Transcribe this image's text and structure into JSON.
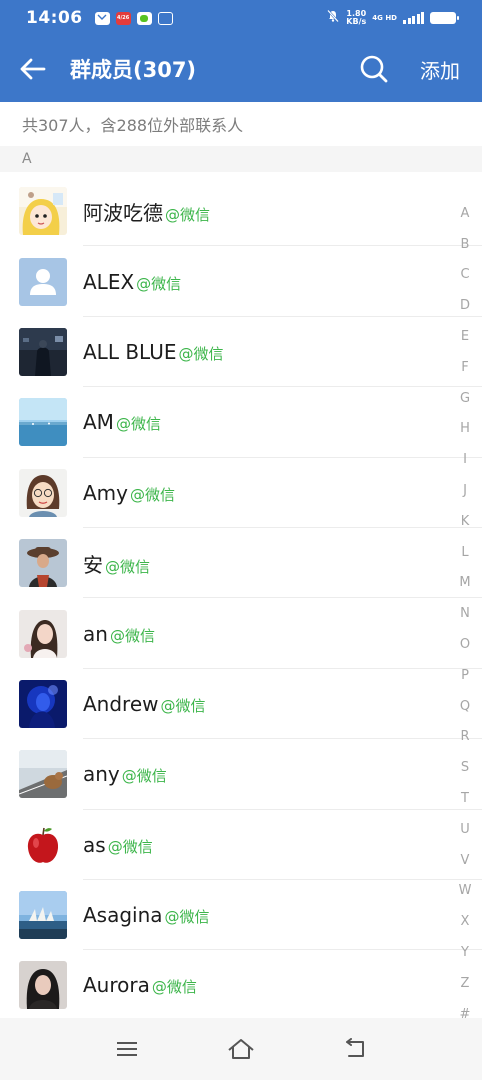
{
  "status_bar": {
    "time": "14:06",
    "net_speed": "1.80",
    "net_unit": "KB/s",
    "net_type": "4G HD",
    "notif_red_label": "4/26"
  },
  "header": {
    "title": "群成员(307)",
    "add_label": "添加"
  },
  "summary": "共307人，含288位外部联系人",
  "section_letter": "A",
  "members": [
    {
      "name": "阿波吃德",
      "tag": "@微信",
      "avatar": "anime-girl"
    },
    {
      "name": "ALEX",
      "tag": "@微信",
      "avatar": "default-person"
    },
    {
      "name": "ALL BLUE",
      "tag": "@微信",
      "avatar": "dark-photo"
    },
    {
      "name": "AM",
      "tag": "@微信",
      "avatar": "sea"
    },
    {
      "name": "Amy",
      "tag": "@微信",
      "avatar": "cartoon-face"
    },
    {
      "name": "安",
      "tag": "@微信",
      "avatar": "hat-portrait"
    },
    {
      "name": "an",
      "tag": "@微信",
      "avatar": "light-portrait"
    },
    {
      "name": "Andrew",
      "tag": "@微信",
      "avatar": "blue-portrait"
    },
    {
      "name": "any",
      "tag": "@微信",
      "avatar": "road-dog"
    },
    {
      "name": "as",
      "tag": "@微信",
      "avatar": "apple"
    },
    {
      "name": "Asagina",
      "tag": "@微信",
      "avatar": "opera-house"
    },
    {
      "name": "Aurora",
      "tag": "@微信",
      "avatar": "dark-portrait"
    }
  ],
  "index_letters": [
    "A",
    "B",
    "C",
    "D",
    "E",
    "F",
    "G",
    "H",
    "I",
    "J",
    "K",
    "L",
    "M",
    "N",
    "O",
    "P",
    "Q",
    "R",
    "S",
    "T",
    "U",
    "V",
    "W",
    "X",
    "Y",
    "Z",
    "#"
  ],
  "colors": {
    "header_bg": "#3d77c9",
    "tag_green": "#3cb54a"
  },
  "icons": {
    "back": "back-arrow-icon",
    "search": "search-icon",
    "menu": "menu-icon",
    "home": "home-icon",
    "return": "return-icon"
  }
}
